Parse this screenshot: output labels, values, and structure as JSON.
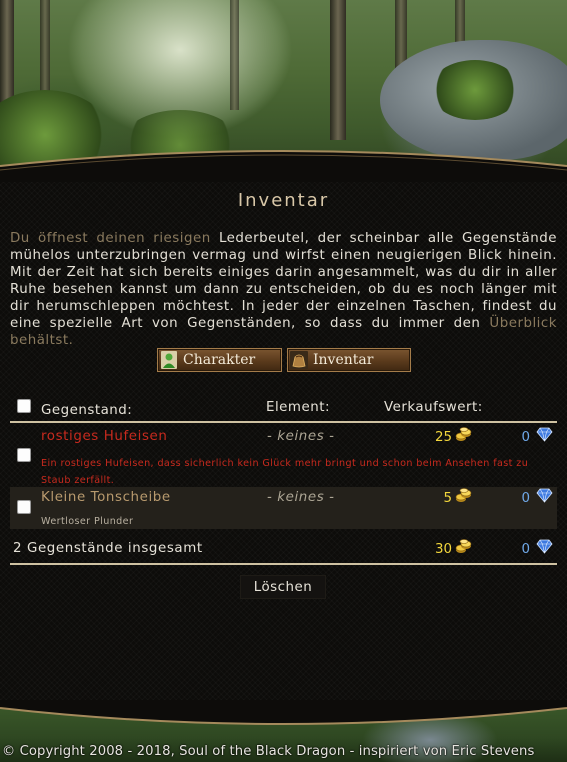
{
  "page_title": "Inventar",
  "intro": {
    "part1": "Du öffnest deinen riesigen",
    "part2": " Lederbeutel, der scheinbar alle Gegenstände mühelos unterzubringen vermag und wirfst einen neugierigen Blick hinein. Mit der Zeit hat sich bereits einiges darin angesammelt, was du dir in aller Ruhe besehen kannst um dann zu entscheiden, ob du es noch länger mit dir herumschleppen möchtest. In jeder der einzelnen Taschen, findest du eine spezielle Art von Gegenständen, so dass du immer den",
    "part3": " Überblick behältst."
  },
  "nav": {
    "character_label": "Charakter",
    "inventory_label": "Inventar"
  },
  "table": {
    "headers": {
      "item": "Gegenstand:",
      "element": "Element:",
      "value": "Verkaufswert:"
    },
    "rows": [
      {
        "name": "rostiges Hufeisen",
        "description": "Ein rostiges Hufeisen, dass sicherlich kein Glück mehr bringt und schon beim Ansehen fast zu Staub zerfällt.",
        "element": "- keines -",
        "gold": "25",
        "gems": "0",
        "name_color": "#c82a1e",
        "desc_color": "#c82a1e"
      },
      {
        "name": "Kleine Tonscheibe",
        "description": "Wertloser Plunder",
        "element": "- keines -",
        "gold": "5",
        "gems": "0",
        "name_color": "#b89a6e",
        "desc_color": "#b8b0a0"
      }
    ],
    "total_label": "2 Gegenstände insgesamt",
    "total_gold": "30",
    "total_gems": "0"
  },
  "delete_label": "Löschen",
  "footer": {
    "copyright": "© Copyright 2008 - 2018, Soul of the Black Dragon - inspiriert von Eric Stevens"
  },
  "icons": {
    "gold": "gold-coins-icon",
    "gem": "blue-gem-icon",
    "character": "character-icon",
    "inventory": "bag-icon"
  },
  "colors": {
    "title": "#d8c7a8",
    "gold_text": "#f2d63c",
    "gem_text": "#6fa8e8",
    "rule": "#cfc2a2"
  }
}
